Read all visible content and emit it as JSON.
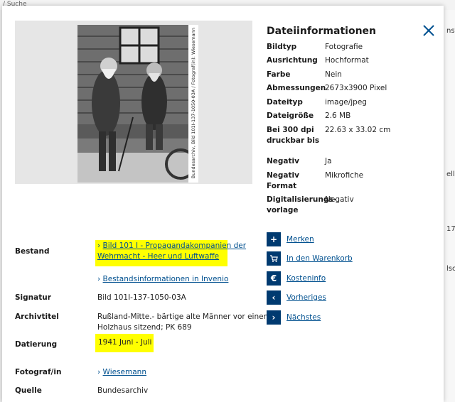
{
  "background": {
    "top_text": "/ Suche",
    "right_fragments": [
      "nst",
      "ell",
      "17 -",
      "lsc"
    ]
  },
  "colors": {
    "accent": "#003a70",
    "link": "#00508f",
    "highlight": "#ffff00"
  },
  "icons": {
    "close": "close-icon",
    "merken": "plus-icon",
    "warenkorb": "cart-icon",
    "kosten": "euro-icon",
    "vorheriges": "chevron-left-icon",
    "naechstes": "chevron-right-icon"
  },
  "photo": {
    "side_caption": "Bundesarchiv, Bild 101I-137-1050-03A / Fotograf(in): Wiesemann"
  },
  "file_info": {
    "title": "Dateiinformationen",
    "rows": [
      {
        "label": "Bildtyp",
        "value": "Fotografie"
      },
      {
        "label": "Ausrichtung",
        "value": "Hochformat"
      },
      {
        "label": "Farbe",
        "value": "Nein"
      },
      {
        "label": "Abmessungen",
        "value": "2673x3900 Pixel"
      },
      {
        "label": "Dateityp",
        "value": "image/jpeg"
      },
      {
        "label": "Dateigröße",
        "value": "2.6 MB"
      },
      {
        "label": "Bei 300 dpi druckbar bis",
        "value": "22.63 x 33.02 cm"
      },
      {
        "label": "Negativ",
        "value": "Ja"
      },
      {
        "label": "Negativ Format",
        "value": "Mikrofiche"
      },
      {
        "label": "Digitalisierungs-vorlage",
        "value": "Negativ"
      }
    ]
  },
  "meta": {
    "bestand_label": "Bestand",
    "bestand_link_line1": "Bild 101 I - Propagandakompanien der",
    "bestand_link_line2": "Wehrmacht - Heer und Luftwaffe",
    "bestand_info_link": "Bestandsinformationen in Invenio",
    "signatur_label": "Signatur",
    "signatur_value": "Bild 101I-137-1050-03A",
    "archivtitel_label": "Archivtitel",
    "archivtitel_line1": "Rußland-Mitte.- bärtige alte Männer vor einem",
    "archivtitel_line2": "Holzhaus sitzend; PK 689",
    "datierung_label": "Datierung",
    "datierung_value": "1941 Juni - Juli",
    "fotograf_label": "Fotograf/in",
    "fotograf_value": "Wiesemann",
    "quelle_label": "Quelle",
    "quelle_value": "Bundesarchiv"
  },
  "actions": {
    "merken": "Merken",
    "warenkorb": "In den Warenkorb",
    "kosteninfo": "Kosteninfo",
    "vorheriges": "Vorheriges",
    "naechstes": "Nächstes"
  }
}
